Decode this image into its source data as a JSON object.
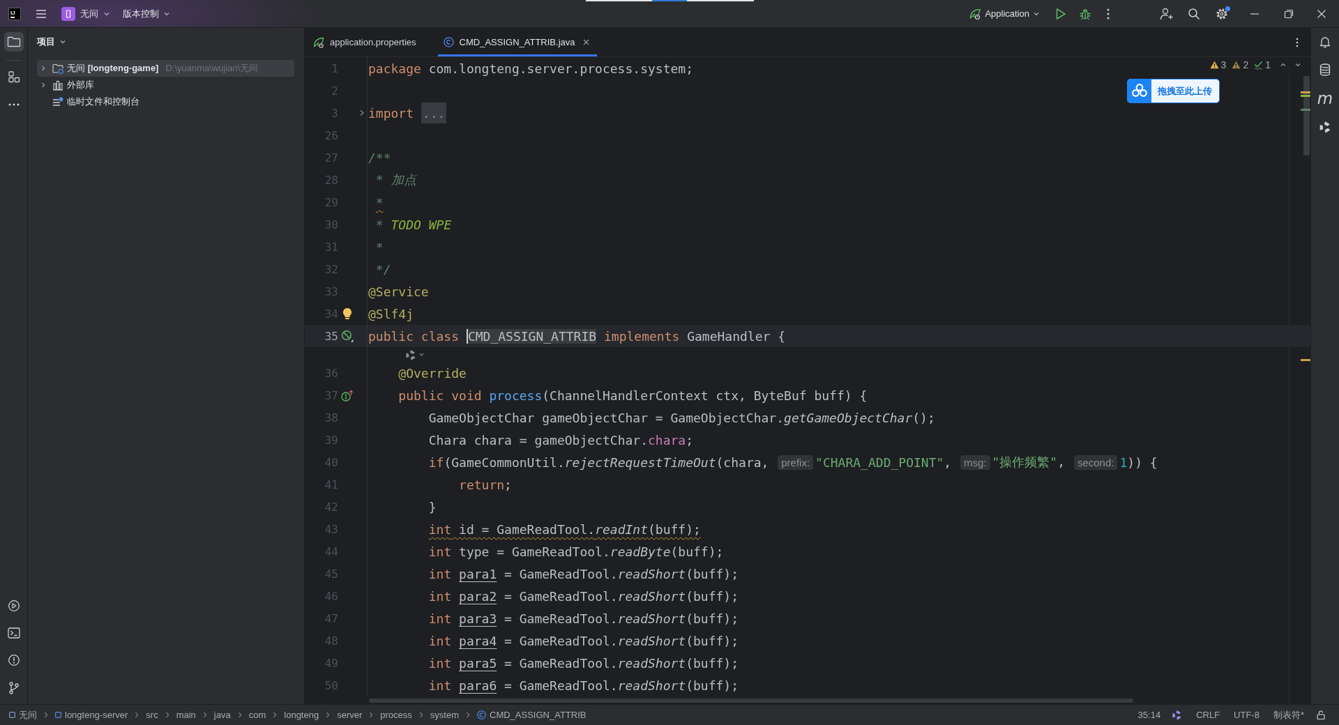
{
  "title_bar": {
    "logo": "IJ",
    "project": "无间",
    "vcs": "版本控制",
    "run_config": "Application",
    "settings_badge": true
  },
  "left_toolbar": [
    {
      "selected": true
    },
    {
      "selected": false
    },
    {
      "selected": false
    }
  ],
  "project_panel": {
    "title": "项目",
    "tree": [
      {
        "label": "无间 **[longteng-game]**",
        "path": "D:\\yuanma\\wujian\\无间",
        "kind": "project",
        "selected": true,
        "expanded": false
      },
      {
        "label": "外部库",
        "kind": "library",
        "selected": false,
        "expanded": false
      },
      {
        "label": "临时文件和控制台",
        "kind": "scratch",
        "selected": false
      }
    ]
  },
  "editor": {
    "tabs": [
      {
        "label": "application.properties",
        "kind": "properties",
        "selected": false
      },
      {
        "label": "CMD_ASSIGN_ATTRIB.java",
        "kind": "class",
        "selected": true
      }
    ],
    "inspections": {
      "warnings": "3",
      "weak_warnings": "2",
      "typos": "1"
    },
    "upload_button": "拖拽至此上传",
    "lines": [
      {
        "kind": "code",
        "number": "1",
        "current": false,
        "warning": false,
        "tokens": [
          {
            "kind": "keyword",
            "text": "package"
          },
          {
            "kind": "plain",
            "text": " com.longteng.server.process.system;"
          }
        ]
      },
      {
        "kind": "code",
        "number": "2",
        "current": false
      },
      {
        "kind": "code",
        "number": "3",
        "current": false,
        "warning": false,
        "gutter": {
          "kind": "fold"
        },
        "tokens": [
          {
            "kind": "keyword",
            "text": "import "
          },
          {
            "kind": "fold",
            "text": "..."
          }
        ]
      },
      {
        "kind": "code",
        "number": "26",
        "current": false
      },
      {
        "kind": "code",
        "number": "27",
        "current": false,
        "warning": false,
        "tokens": [
          {
            "kind": "doc",
            "text": "/**"
          }
        ]
      },
      {
        "kind": "code",
        "number": "28",
        "current": false,
        "warning": false,
        "tokens": [
          {
            "kind": "doc",
            "text": " * 加点"
          }
        ]
      },
      {
        "kind": "code",
        "number": "29",
        "current": false,
        "warning": true,
        "tokens": [
          {
            "kind": "doc",
            "text": " *"
          }
        ]
      },
      {
        "kind": "code",
        "number": "30",
        "current": false,
        "warning": false,
        "tokens": [
          {
            "kind": "doc",
            "text": " * "
          },
          {
            "kind": "todo",
            "text": "TODO WPE"
          }
        ]
      },
      {
        "kind": "code",
        "number": "31",
        "current": false,
        "warning": false,
        "tokens": [
          {
            "kind": "doc",
            "text": " *"
          }
        ]
      },
      {
        "kind": "code",
        "number": "32",
        "current": false,
        "warning": false,
        "tokens": [
          {
            "kind": "doc",
            "text": " */"
          }
        ]
      },
      {
        "kind": "code",
        "number": "33",
        "current": false,
        "warning": false,
        "tokens": [
          {
            "kind": "annotation",
            "text": "@Service"
          }
        ]
      },
      {
        "kind": "code",
        "number": "34",
        "current": false,
        "warning": false,
        "gutter": {
          "kind": "bulb"
        },
        "tokens": [
          {
            "kind": "annotation",
            "text": "@Slf4j"
          }
        ]
      },
      {
        "kind": "code",
        "number": "35",
        "current": true,
        "warning": false,
        "gutter": {
          "kind": "bean"
        },
        "tokens": [
          {
            "kind": "keyword",
            "text": "public class "
          },
          {
            "kind": "usage",
            "text": "CMD_ASSIGN_ATTRIB"
          },
          {
            "kind": "keyword",
            "text": " implements "
          },
          {
            "kind": "plain",
            "text": "GameHandler {"
          }
        ]
      },
      {
        "kind": "inlay"
      },
      {
        "kind": "code",
        "number": "36",
        "current": false,
        "warning": false,
        "tokens": [
          {
            "kind": "annotation",
            "text": "    @Override"
          }
        ]
      },
      {
        "kind": "code",
        "number": "37",
        "current": false,
        "warning": false,
        "gutter": {
          "kind": "implements"
        },
        "tokens": [
          {
            "kind": "keyword",
            "text": "    public void "
          },
          {
            "kind": "declaration",
            "text": "process"
          },
          {
            "kind": "plain",
            "text": "(ChannelHandlerContext ctx, ByteBuf buff) {"
          }
        ]
      },
      {
        "kind": "code",
        "number": "38",
        "current": false,
        "warning": false,
        "tokens": [
          {
            "kind": "plain",
            "text": "        GameObjectChar gameObjectChar = GameObjectChar."
          },
          {
            "kind": "static",
            "text": "getGameObjectChar"
          },
          {
            "kind": "plain",
            "text": "();"
          }
        ]
      },
      {
        "kind": "code",
        "number": "39",
        "current": false,
        "warning": false,
        "tokens": [
          {
            "kind": "plain",
            "text": "        Chara chara = gameObjectChar."
          },
          {
            "kind": "field",
            "text": "chara"
          },
          {
            "kind": "plain",
            "text": ";"
          }
        ]
      },
      {
        "kind": "code",
        "number": "40",
        "current": false,
        "warning": false,
        "tokens": [
          {
            "kind": "keyword",
            "text": "        if"
          },
          {
            "kind": "plain",
            "text": "(GameCommonUtil."
          },
          {
            "kind": "static",
            "text": "rejectRequestTimeOut"
          },
          {
            "kind": "plain",
            "text": "(chara, "
          },
          {
            "kind": "hint",
            "text": "prefix:"
          },
          {
            "kind": "string",
            "text": "\"CHARA_ADD_POINT\""
          },
          {
            "kind": "plain",
            "text": ", "
          },
          {
            "kind": "hint",
            "text": "msg:"
          },
          {
            "kind": "string",
            "text": "\"操作频繁\""
          },
          {
            "kind": "plain",
            "text": ", "
          },
          {
            "kind": "hint",
            "text": "second:"
          },
          {
            "kind": "number",
            "text": "1"
          },
          {
            "kind": "plain",
            "text": ")) {"
          }
        ]
      },
      {
        "kind": "code",
        "number": "41",
        "current": false,
        "warning": false,
        "tokens": [
          {
            "kind": "keyword",
            "text": "            return"
          },
          {
            "kind": "plain",
            "text": ";"
          }
        ]
      },
      {
        "kind": "code",
        "number": "42",
        "current": false,
        "warning": false,
        "tokens": [
          {
            "kind": "plain",
            "text": "        }"
          }
        ]
      },
      {
        "kind": "code",
        "number": "43",
        "current": false,
        "warning": true,
        "tokens": [
          {
            "kind": "keyword",
            "text": "        int"
          },
          {
            "kind": "plain",
            "text": " id = GameReadTool."
          },
          {
            "kind": "static",
            "text": "readInt"
          },
          {
            "kind": "plain",
            "text": "(buff);"
          }
        ]
      },
      {
        "kind": "code",
        "number": "44",
        "current": false,
        "warning": false,
        "tokens": [
          {
            "kind": "keyword",
            "text": "        int"
          },
          {
            "kind": "plain",
            "text": " type = GameReadTool."
          },
          {
            "kind": "static",
            "text": "readByte"
          },
          {
            "kind": "plain",
            "text": "(buff);"
          }
        ]
      },
      {
        "kind": "code",
        "number": "45",
        "current": false,
        "warning": false,
        "tokens": [
          {
            "kind": "keyword",
            "text": "        int "
          },
          {
            "kind": "reassigned",
            "text": "para1"
          },
          {
            "kind": "plain",
            "text": " = GameReadTool."
          },
          {
            "kind": "static",
            "text": "readShort"
          },
          {
            "kind": "plain",
            "text": "(buff);"
          }
        ]
      },
      {
        "kind": "code",
        "number": "46",
        "current": false,
        "warning": false,
        "tokens": [
          {
            "kind": "keyword",
            "text": "        int "
          },
          {
            "kind": "reassigned",
            "text": "para2"
          },
          {
            "kind": "plain",
            "text": " = GameReadTool."
          },
          {
            "kind": "static",
            "text": "readShort"
          },
          {
            "kind": "plain",
            "text": "(buff);"
          }
        ]
      },
      {
        "kind": "code",
        "number": "47",
        "current": false,
        "warning": false,
        "tokens": [
          {
            "kind": "keyword",
            "text": "        int "
          },
          {
            "kind": "reassigned",
            "text": "para3"
          },
          {
            "kind": "plain",
            "text": " = GameReadTool."
          },
          {
            "kind": "static",
            "text": "readShort"
          },
          {
            "kind": "plain",
            "text": "(buff);"
          }
        ]
      },
      {
        "kind": "code",
        "number": "48",
        "current": false,
        "warning": false,
        "tokens": [
          {
            "kind": "keyword",
            "text": "        int "
          },
          {
            "kind": "reassigned",
            "text": "para4"
          },
          {
            "kind": "plain",
            "text": " = GameReadTool."
          },
          {
            "kind": "static",
            "text": "readShort"
          },
          {
            "kind": "plain",
            "text": "(buff);"
          }
        ]
      },
      {
        "kind": "code",
        "number": "49",
        "current": false,
        "warning": false,
        "tokens": [
          {
            "kind": "keyword",
            "text": "        int "
          },
          {
            "kind": "reassigned",
            "text": "para5"
          },
          {
            "kind": "plain",
            "text": " = GameReadTool."
          },
          {
            "kind": "static",
            "text": "readShort"
          },
          {
            "kind": "plain",
            "text": "(buff);"
          }
        ]
      },
      {
        "kind": "code",
        "number": "50",
        "current": false,
        "warning": false,
        "tokens": [
          {
            "kind": "keyword",
            "text": "        int "
          },
          {
            "kind": "reassigned",
            "text": "para6"
          },
          {
            "kind": "plain",
            "text": " = GameReadTool."
          },
          {
            "kind": "static",
            "text": "readShort"
          },
          {
            "kind": "plain",
            "text": "(buff);"
          }
        ]
      }
    ]
  },
  "right_toolbar": {
    "maven": "m"
  },
  "status_bar": {
    "breadcrumbs": [
      {
        "label": "无间",
        "kind": "project"
      },
      {
        "label": "longteng-server",
        "kind": "module"
      },
      {
        "label": "src",
        "kind": "directory"
      },
      {
        "label": "main",
        "kind": "directory"
      },
      {
        "label": "java",
        "kind": "directory"
      },
      {
        "label": "com",
        "kind": "directory"
      },
      {
        "label": "longteng",
        "kind": "directory"
      },
      {
        "label": "server",
        "kind": "directory"
      },
      {
        "label": "process",
        "kind": "directory"
      },
      {
        "label": "system",
        "kind": "directory"
      },
      {
        "label": "CMD_ASSIGN_ATTRIB",
        "kind": "class"
      }
    ],
    "caret": "35:14",
    "line_separator": "CRLF",
    "encoding": "UTF-8",
    "indent": "制表符*"
  }
}
